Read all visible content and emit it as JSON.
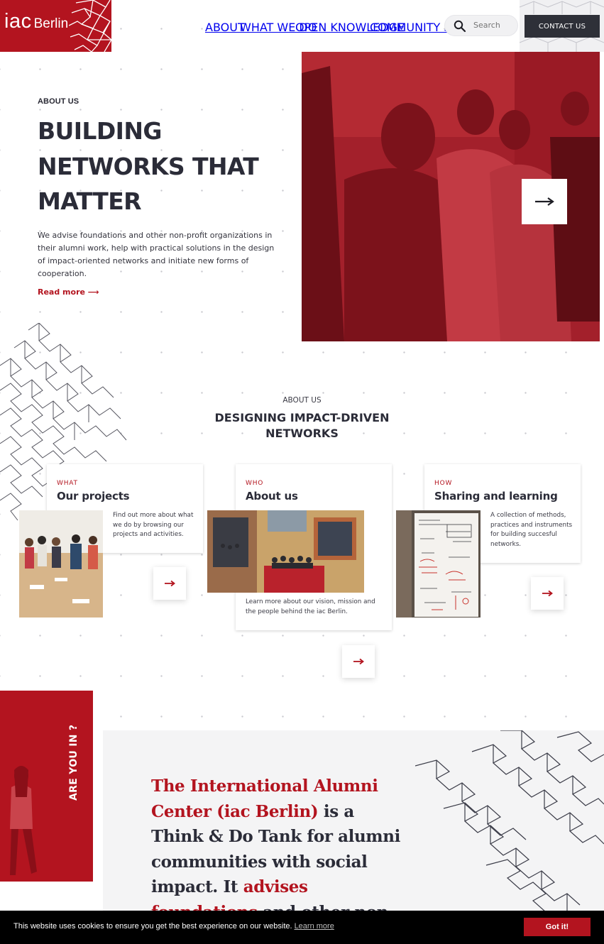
{
  "brand": {
    "logo_main": "iac",
    "logo_sub": "Berlin",
    "accent": "#b3141f",
    "dark": "#2e3038"
  },
  "nav": {
    "items": [
      "ABOUT",
      "WHAT WE DO",
      "OPEN KNOWLEDGE",
      "COMMUNITY SPACE"
    ]
  },
  "search": {
    "placeholder": "Search",
    "icon": "search-icon"
  },
  "contact": {
    "label": "CONTACT US"
  },
  "hero": {
    "eyebrow": "ABOUT US",
    "title_lines": [
      "BUILDING",
      "NETWORKS THAT",
      "MATTER"
    ],
    "paragraph": "We advise foundations and other non-profit organizations in their alumni work, help with practical solutions in the design of impact-oriented networks and initiate new forms of cooperation.",
    "read_more": "Read more ⟶",
    "arrow_icon": "arrow-right-icon"
  },
  "section": {
    "eyebrow": "ABOUT US",
    "title": "DESIGNING IMPACT-DRIVEN NETWORKS"
  },
  "cards": [
    {
      "kicker": "WHAT",
      "title": "Our projects",
      "desc": "Find out more about what we do by browsing our projects and activities."
    },
    {
      "kicker": "WHO",
      "title": "About us",
      "desc": "Learn more about our vision, mission and the people behind the iac Berlin."
    },
    {
      "kicker": "HOW",
      "title": "Sharing and learning",
      "desc": "A collection of methods, practices and instruments for building succesful networks."
    }
  ],
  "side_panel": {
    "text": "ARE YOU IN ?"
  },
  "statement": {
    "red1": "The International Alumni Center (iac Berlin)",
    "dark1": " is a Think & Do Tank for alumni communities with social impact. It ",
    "red2": "advises foundations",
    "dark2": " and other non-"
  },
  "cookie": {
    "text": "This website uses cookies to ensure you get the best experience on our website.",
    "link": "Learn more",
    "button": "Got it!"
  }
}
